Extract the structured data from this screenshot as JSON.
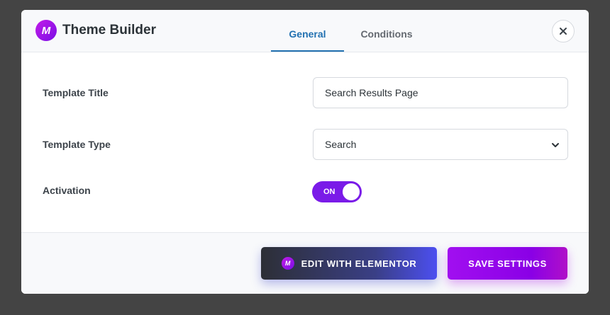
{
  "header": {
    "logo_letter": "M",
    "title": "Theme Builder",
    "tabs": [
      {
        "label": "General",
        "active": true
      },
      {
        "label": "Conditions",
        "active": false
      }
    ],
    "close_icon": "close-icon"
  },
  "form": {
    "template_title": {
      "label": "Template Title",
      "value": "Search Results Page"
    },
    "template_type": {
      "label": "Template Type",
      "value": "Search"
    },
    "activation": {
      "label": "Activation",
      "state": "ON"
    }
  },
  "footer": {
    "edit_button": {
      "logo_letter": "M",
      "label": "EDIT WITH ELEMENTOR"
    },
    "save_button": {
      "label": "SAVE SETTINGS"
    }
  },
  "colors": {
    "accent_blue": "#2271b1",
    "purple": "#7a1be8",
    "backdrop": "#444444"
  }
}
